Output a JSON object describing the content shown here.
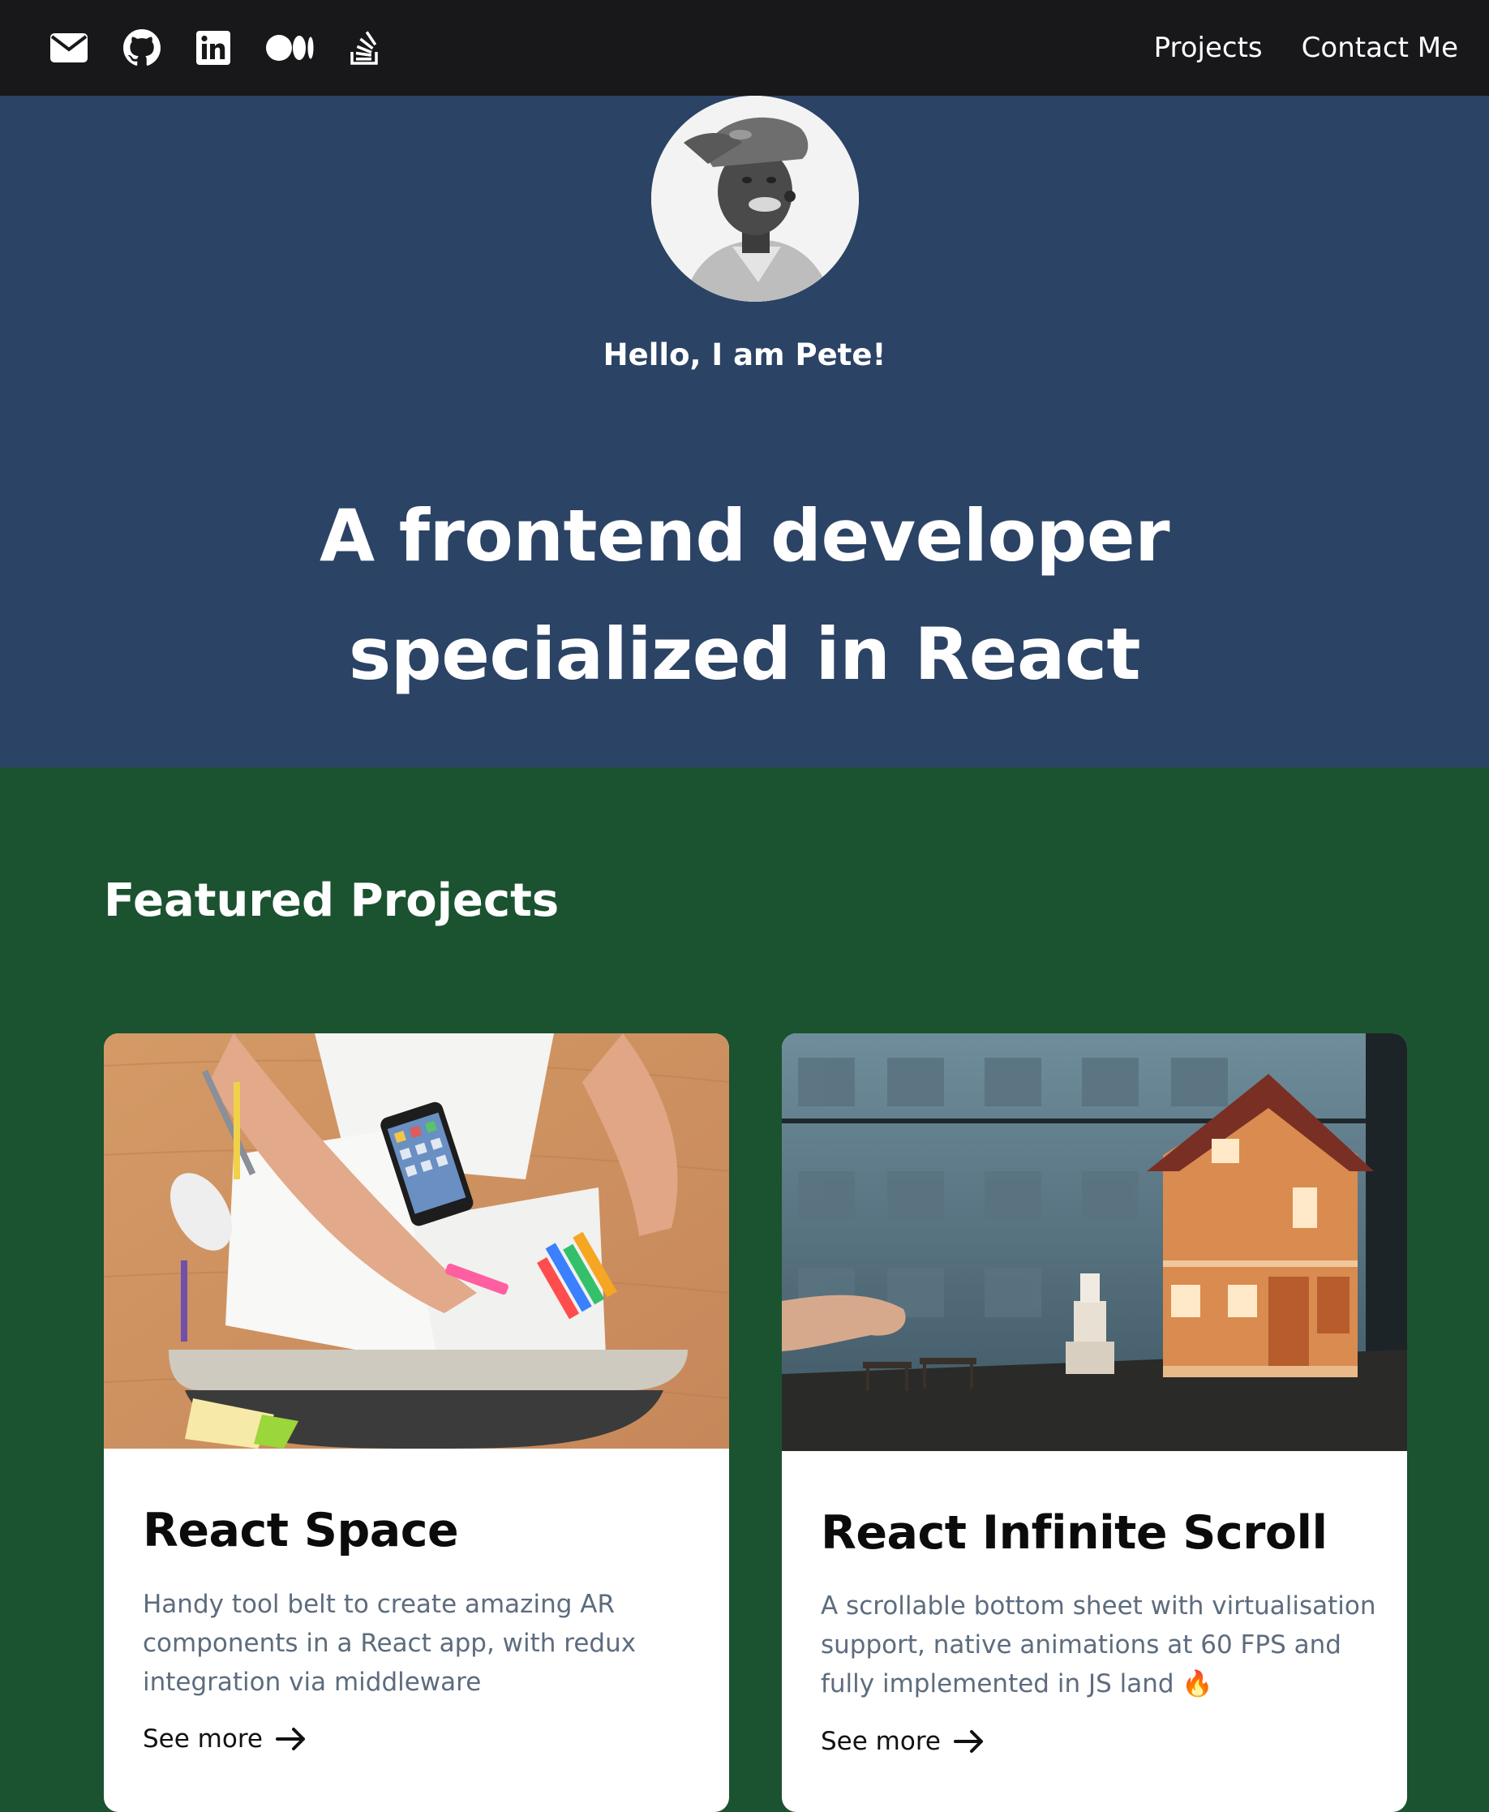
{
  "nav": {
    "social": [
      {
        "name": "envelope-icon"
      },
      {
        "name": "github-icon"
      },
      {
        "name": "linkedin-icon"
      },
      {
        "name": "medium-icon"
      },
      {
        "name": "stackoverflow-icon"
      }
    ],
    "links": [
      "Projects",
      "Contact Me"
    ]
  },
  "hero": {
    "greeting": "Hello, I am Pete!",
    "headline_line1": "A frontend developer",
    "headline_line2": "specialized in React"
  },
  "projects": {
    "title": "Featured Projects",
    "cards": [
      {
        "title": "React Space",
        "description": "Handy tool belt to create amazing AR components in a React app, with redux integration via middleware",
        "cta": "See more"
      },
      {
        "title": "React Infinite Scroll",
        "description": "A scrollable bottom sheet with virtualisation support, native animations at 60 FPS and fully implemented in JS land 🔥",
        "cta": "See more"
      }
    ]
  },
  "colors": {
    "navbar": "#18181b",
    "hero": "#2b4365",
    "projects": "#1b5230",
    "card": "#ffffff",
    "muted_text": "#5d6c7e"
  }
}
